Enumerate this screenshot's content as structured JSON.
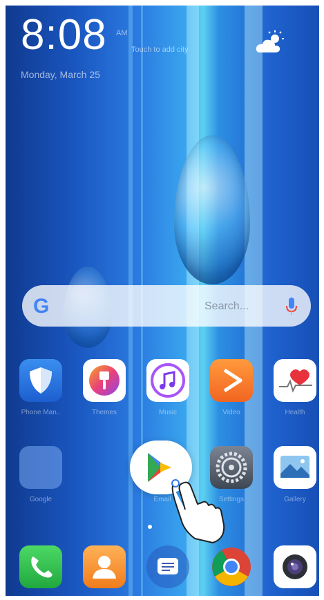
{
  "status": {
    "time": "8:08",
    "ampm": "AM",
    "touch_to_add_city": "Touch to add city",
    "date": "Monday, March 25"
  },
  "search": {
    "placeholder": "Search..."
  },
  "apps_row1": [
    "Phone Man..",
    "Themes",
    "Music",
    "Video",
    "Health"
  ],
  "apps_row2": [
    "Google",
    "Email",
    "Settings",
    "Gallery"
  ]
}
